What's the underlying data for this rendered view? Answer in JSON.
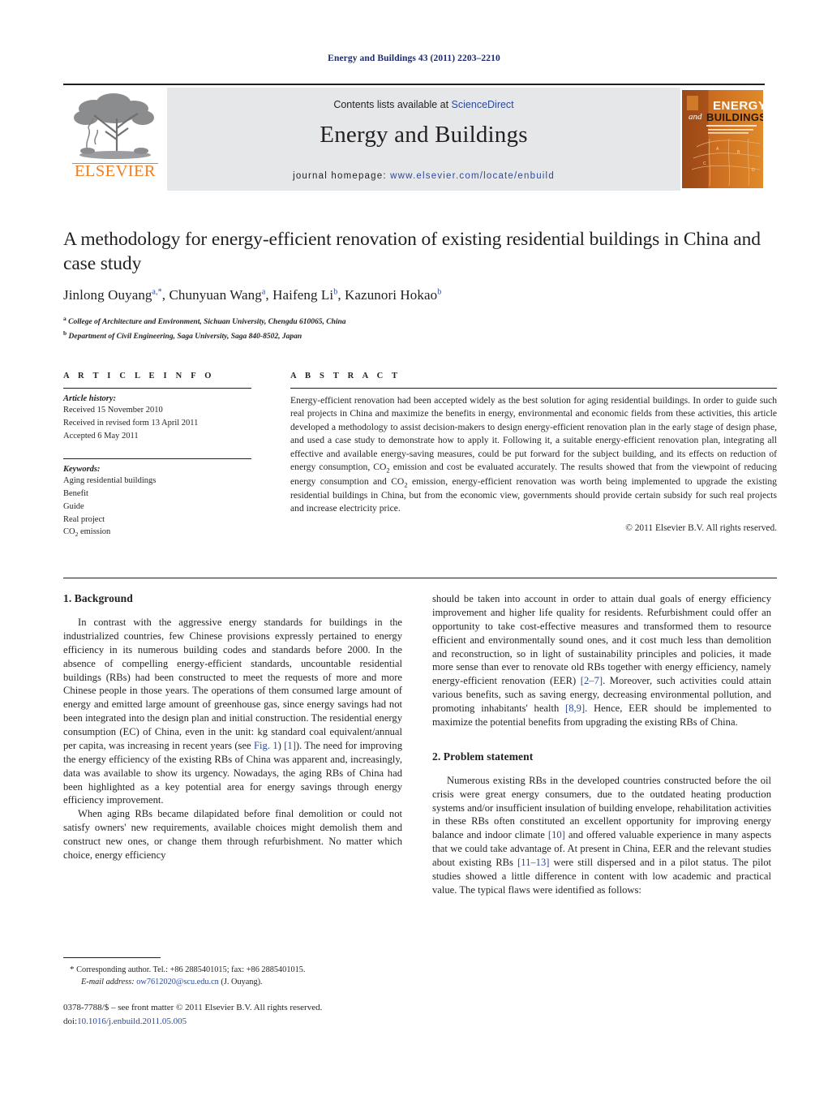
{
  "running_head": "Energy and Buildings 43 (2011) 2203–2210",
  "masthead": {
    "contents_prefix": "Contents lists available at ",
    "sciencedirect": "ScienceDirect",
    "journal_name": "Energy and Buildings",
    "homepage_label": "journal homepage:",
    "homepage_url": "www.elsevier.com/locate/enbuild",
    "publisher": "ELSEVIER",
    "cover_line1": "ENERGY",
    "cover_and": "and",
    "cover_line2": "BUILDINGS",
    "cover_sub": "An international journal devoted to investigations of energy use and efficiency in buildings",
    "brand_orange": "#f07d20",
    "link_blue": "#2b4a9b",
    "band_gray": "#e6e7e9"
  },
  "title": "A methodology for energy-efficient renovation of existing residential buildings in China and case study",
  "authors_html": "Jinlong Ouyang<sup>a,*</sup>, Chunyuan Wang<sup>a</sup>, Haifeng Li<sup>b</sup>, Kazunori Hokao<sup>b</sup>",
  "affiliations": [
    "College of Architecture and Environment, Sichuan University, Chengdu 610065, China",
    "Department of Civil Engineering, Saga University, Saga 840-8502, Japan"
  ],
  "article_info": {
    "heading": "A R T I C L E   I N F O",
    "history_label": "Article history:",
    "history": [
      "Received 15 November 2010",
      "Received in revised form 13 April 2011",
      "Accepted 6 May 2011"
    ],
    "keywords_label": "Keywords:",
    "keywords": [
      "Aging residential buildings",
      "Benefit",
      "Guide",
      "Real project",
      "CO2 emission"
    ]
  },
  "abstract": {
    "heading": "A B S T R A C T",
    "text": "Energy-efficient renovation had been accepted widely as the best solution for aging residential buildings. In order to guide such real projects in China and maximize the benefits in energy, environmental and economic fields from these activities, this article developed a methodology to assist decision-makers to design energy-efficient renovation plan in the early stage of design phase, and used a case study to demonstrate how to apply it. Following it, a suitable energy-efficient renovation plan, integrating all effective and available energy-saving measures, could be put forward for the subject building, and its effects on reduction of energy consumption, CO2 emission and cost be evaluated accurately. The results showed that from the viewpoint of reducing energy consumption and CO2 emission, energy-efficient renovation was worth being implemented to upgrade the existing residential buildings in China, but from the economic view, governments should provide certain subsidy for such real projects and increase electricity price.",
    "copyright": "© 2011 Elsevier B.V. All rights reserved."
  },
  "sections": {
    "background_heading": "1.  Background",
    "background_p1": "In contrast with the aggressive energy standards for buildings in the industrialized countries, few Chinese provisions expressly pertained to energy efficiency in its numerous building codes and standards before 2000. In the absence of compelling energy-efficient standards, uncountable residential buildings (RBs) had been constructed to meet the requests of more and more Chinese people in those years. The operations of them consumed large amount of energy and emitted large amount of greenhouse gas, since energy savings had not been integrated into the design plan and initial construction. The residential energy consumption (EC) of China, even in the unit: kg standard coal equivalent/annual per capita, was increasing in recent years (see ",
    "background_p1_ref_fig": "Fig. 1",
    "background_p1_ref_1": "[1]",
    "background_p1_cont": "). The need for improving the energy efficiency of the existing RBs of China was apparent and, increasingly, data was available to show its urgency. Nowadays, the aging RBs of China had been highlighted as a key potential area for energy savings through energy efficiency improvement.",
    "background_p2": "When aging RBs became dilapidated before final demolition or could not satisfy owners' new requirements, available choices might demolish them and construct new ones, or change them through refurbishment. No matter which choice, energy efficiency",
    "background_p3_pre": "should be taken into account in order to attain dual goals of energy efficiency improvement and higher life quality for residents. Refurbishment could offer an opportunity to take cost-effective measures and transformed them to resource efficient and environmentally sound ones, and it cost much less than demolition and reconstruction, so in light of sustainability principles and policies, it made more sense than ever to renovate old RBs together with energy efficiency, namely energy-efficient renovation (EER) ",
    "background_p3_ref_27": "[2–7]",
    "background_p3_mid": ". Moreover, such activities could attain various benefits, such as saving energy, decreasing environmental pollution, and promoting inhabitants' health ",
    "background_p3_ref_89": "[8,9]",
    "background_p3_end": ". Hence, EER should be implemented to maximize the potential benefits from upgrading the existing RBs of China.",
    "problem_heading": "2.  Problem statement",
    "problem_p1_pre": "Numerous existing RBs in the developed countries constructed before the oil crisis were great energy consumers, due to the outdated heating production systems and/or insufficient insulation of building envelope, rehabilitation activities in these RBs often constituted an excellent opportunity for improving energy balance and indoor climate ",
    "problem_p1_ref_10": "[10]",
    "problem_p1_mid": " and offered valuable experience in many aspects that we could take advantage of. At present in China, EER and the relevant studies about existing RBs ",
    "problem_p1_ref_1113": "[11–13]",
    "problem_p1_end": " were still dispersed and in a pilot status. The pilot studies showed a little difference in content with low academic and practical value. The typical flaws were identified as follows:"
  },
  "footnote": {
    "star": "*",
    "corresponding": "Corresponding author. Tel.: +86 2885401015; fax: +86 2885401015.",
    "email_label": "E-mail address:",
    "email": "ow7612020@scu.edu.cn",
    "email_owner": "(J. Ouyang)."
  },
  "imprint": {
    "issn_line": "0378-7788/$ – see front matter © 2011 Elsevier B.V. All rights reserved.",
    "doi_label": "doi:",
    "doi": "10.1016/j.enbuild.2011.05.005"
  }
}
